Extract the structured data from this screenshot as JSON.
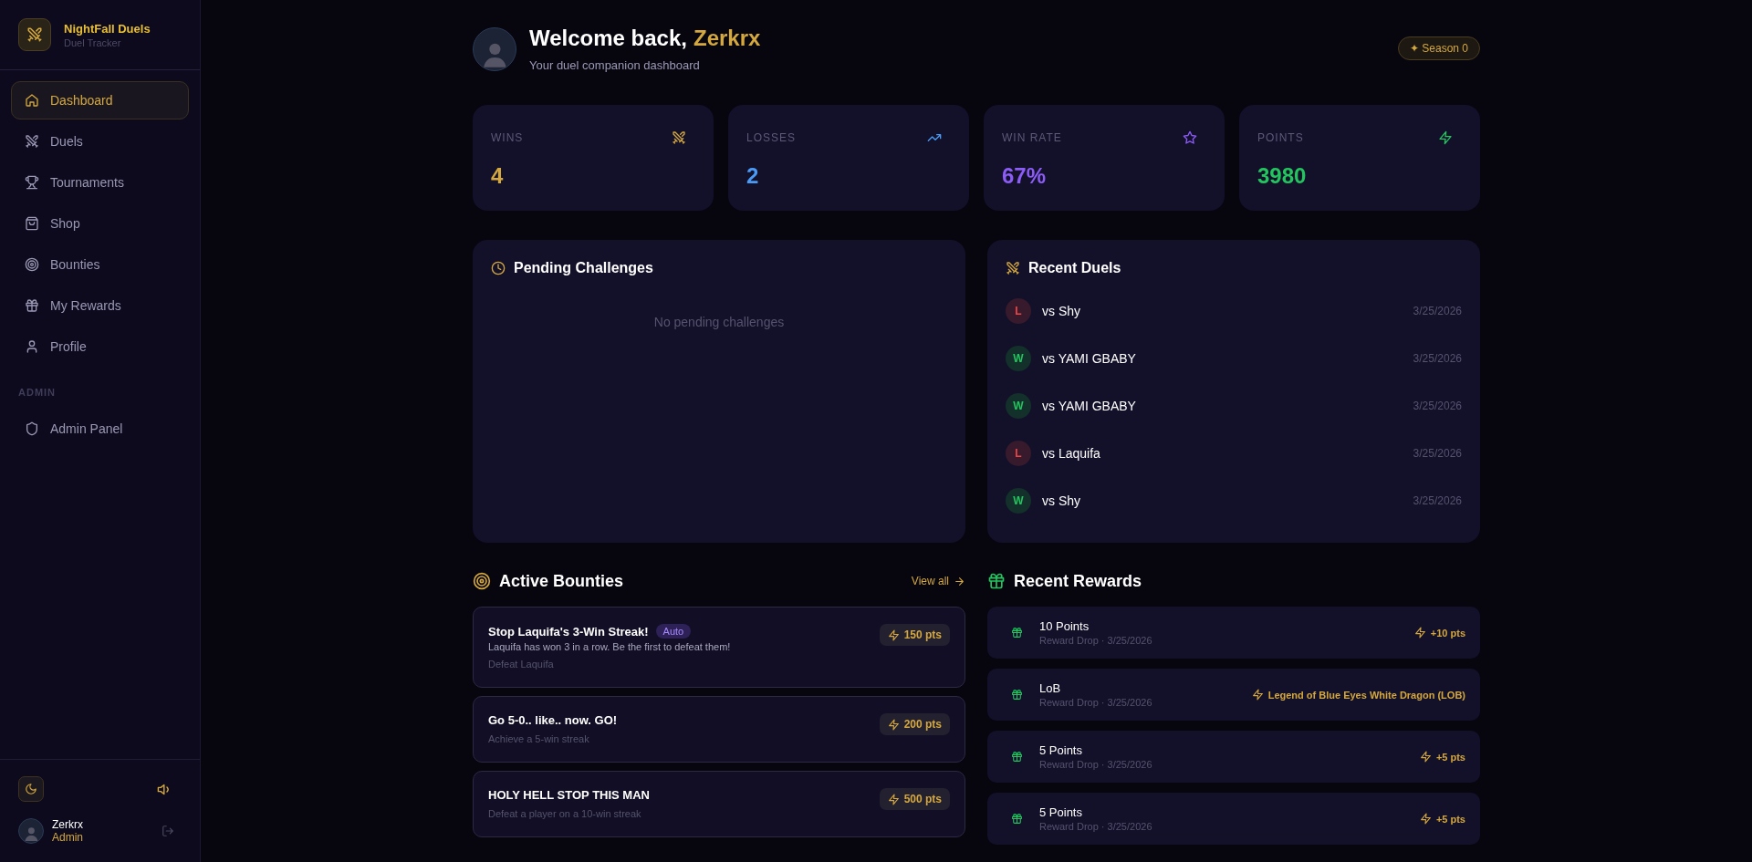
{
  "sidebar": {
    "app_name": "NightFall Duels",
    "app_subtitle": "Duel Tracker",
    "nav": [
      {
        "label": "Dashboard",
        "selected": true
      },
      {
        "label": "Duels",
        "selected": false
      },
      {
        "label": "Tournaments",
        "selected": false
      },
      {
        "label": "Shop",
        "selected": false
      },
      {
        "label": "Bounties",
        "selected": false
      },
      {
        "label": "My Rewards",
        "selected": false
      },
      {
        "label": "Profile",
        "selected": false
      }
    ],
    "admin_heading": "ADMIN",
    "admin_nav": [
      {
        "label": "Admin Panel",
        "selected": false
      }
    ],
    "user": {
      "name": "Zerkrx",
      "role": "Admin"
    }
  },
  "header": {
    "greeting": "Welcome back,",
    "username": "Zerkrx",
    "subtitle": "Your duel companion dashboard",
    "season": "✦ Season 0"
  },
  "stats": [
    {
      "label": "WINS",
      "value": "4",
      "color": "#d4a83e"
    },
    {
      "label": "LOSSES",
      "value": "2",
      "color": "#4a9bf5"
    },
    {
      "label": "WIN RATE",
      "value": "67%",
      "color": "#8b5cf6"
    },
    {
      "label": "POINTS",
      "value": "3980",
      "color": "#22c55e"
    }
  ],
  "pending": {
    "title": "Pending Challenges",
    "empty": "No pending challenges"
  },
  "recent_duels": {
    "title": "Recent Duels",
    "rows": [
      {
        "kind": "loss",
        "result": "L",
        "opponent": "vs Shy",
        "date": "3/25/2026"
      },
      {
        "kind": "win",
        "result": "W",
        "opponent": "vs YAMI GBABY",
        "date": "3/25/2026"
      },
      {
        "kind": "win",
        "result": "W",
        "opponent": "vs YAMI GBABY",
        "date": "3/25/2026"
      },
      {
        "kind": "loss",
        "result": "L",
        "opponent": "vs Laquifa",
        "date": "3/25/2026"
      },
      {
        "kind": "win",
        "result": "W",
        "opponent": "vs Shy",
        "date": "3/25/2026"
      }
    ]
  },
  "bounties": {
    "title": "Active Bounties",
    "view_all": "View all",
    "items": [
      {
        "title": "Stop Laquifa's 3-Win Streak!",
        "tag": "Auto",
        "description": "Laquifa has won 3 in a row. Be the first to defeat them!",
        "requirement": "Defeat Laquifa",
        "points": "150 pts"
      },
      {
        "title": "Go 5-0.. like.. now. GO!",
        "requirement": "Achieve a 5-win streak",
        "points": "200 pts"
      },
      {
        "title": "HOLY HELL STOP THIS MAN",
        "requirement": "Defeat a player on a 10-win streak",
        "points": "500 pts"
      }
    ]
  },
  "rewards": {
    "title": "Recent Rewards",
    "items": [
      {
        "title": "10 Points",
        "meta": "Reward Drop · 3/25/2026",
        "value": "+10 pts"
      },
      {
        "title": "LoB",
        "meta": "Reward Drop · 3/25/2026",
        "value": "Legend of Blue Eyes White Dragon (LOB)"
      },
      {
        "title": "5 Points",
        "meta": "Reward Drop · 3/25/2026",
        "value": "+5 pts"
      },
      {
        "title": "5 Points",
        "meta": "Reward Drop · 3/25/2026",
        "value": "+5 pts"
      }
    ]
  }
}
